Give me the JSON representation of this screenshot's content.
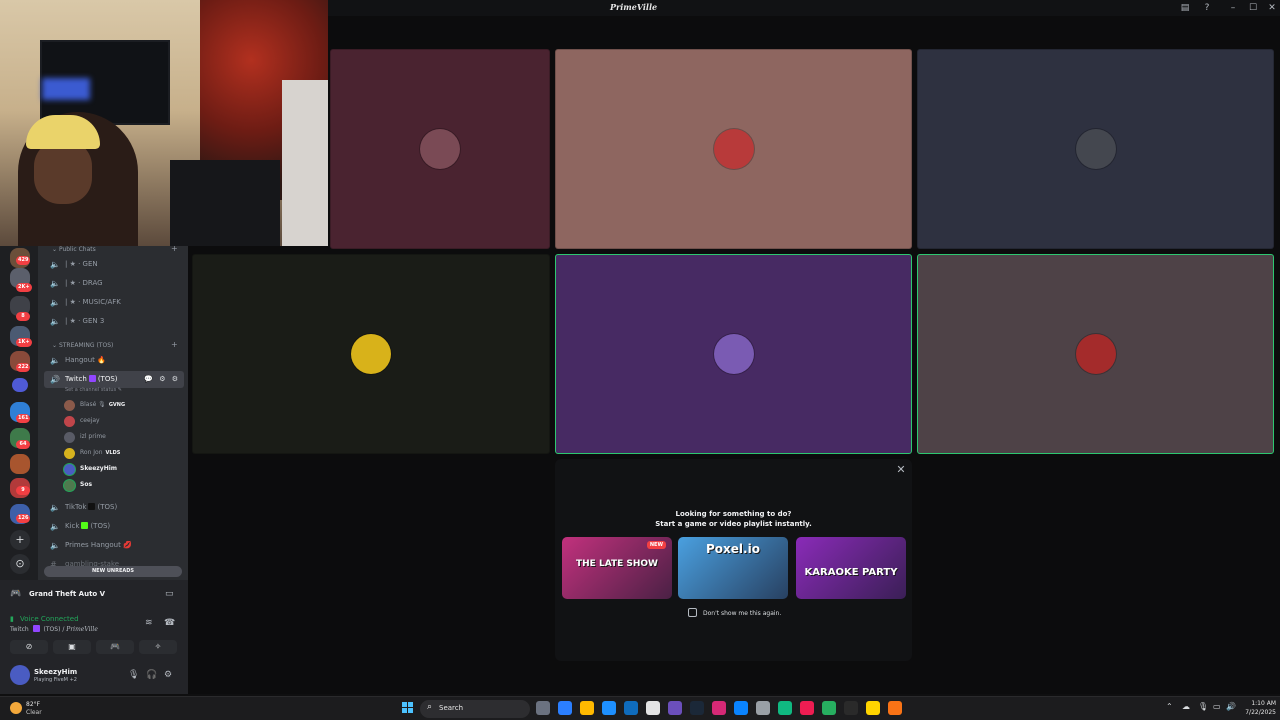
{
  "window": {
    "title": "PrimeVille",
    "controls": {
      "inbox_icon": "inbox-icon",
      "help_icon": "help-icon",
      "minimize": "–",
      "maximize": "☐",
      "close": "✕"
    }
  },
  "server_rail": {
    "badges": [
      "429",
      "2K+",
      "8",
      "1K+",
      "222",
      "161",
      "64",
      "9",
      "126"
    ],
    "add_server_glyph": "+",
    "discover_glyph": "⊙"
  },
  "sidebar": {
    "categories": [
      {
        "label": "Public Chats"
      },
      {
        "label": "STREAMING (TOS)"
      }
    ],
    "public_channels": [
      {
        "label": "| ★ · GEN"
      },
      {
        "label": "| ★ · DRAG"
      },
      {
        "label": "| ★ · MUSIC/AFK"
      },
      {
        "label": "| ★ · GEN 3"
      }
    ],
    "streaming_channels": [
      {
        "label": "Hangout 🔥"
      }
    ],
    "active_channel": {
      "label": "Twitch",
      "suffix": "(TOS)",
      "status": "Set a channel status ✎",
      "tools": "💬 ⚙ ⚙"
    },
    "members": [
      {
        "name": "Blasé 🎙",
        "tag": "GVNG"
      },
      {
        "name": "ceejay",
        "tag": ""
      },
      {
        "name": "izl prime",
        "tag": ""
      },
      {
        "name": "Ron Jon",
        "tag": "VLDS"
      },
      {
        "name": "SkeezyHim",
        "tag": ""
      },
      {
        "name": "Sos",
        "tag": ""
      }
    ],
    "more_channels": [
      {
        "label": "TikTok",
        "suffix": "(TOS)",
        "swatch": "#111111"
      },
      {
        "label": "Kick",
        "suffix": "(TOS)",
        "swatch": "#53fc18"
      },
      {
        "label": "Primes Hangout 💋",
        "suffix": "",
        "swatch": ""
      },
      {
        "label": "gambling-stake",
        "suffix": "",
        "swatch": ""
      }
    ],
    "new_unreads": "NEW UNREADS"
  },
  "user_panel": {
    "game": "Grand Theft Auto V",
    "voice_status": "Voice Connected",
    "voice_channel_prefix": "Twitch",
    "voice_channel_suffix": "(TOS) /",
    "voice_server": "PrimeVille",
    "username": "SkeezyHim",
    "activity": "Playing FiveM +2",
    "buttons": [
      "camera-off-icon",
      "screen-share-icon",
      "activity-icon",
      "soundboard-icon"
    ]
  },
  "stage": {
    "tiles": [
      {
        "bg": "#4a2330",
        "speaking": false,
        "avatar": "#7a4a55"
      },
      {
        "bg": "#8e6660",
        "speaking": false,
        "avatar": "#b83a3a"
      },
      {
        "bg": "#2e3140",
        "speaking": false,
        "avatar": "#44474f"
      },
      {
        "bg": "#1a1c17",
        "speaking": false,
        "avatar": "#d8b21a"
      },
      {
        "bg": "#472a63",
        "speaking": true,
        "avatar": "#7a5bb3"
      },
      {
        "bg": "#4e4247",
        "speaking": true,
        "avatar": "#a42b2b"
      }
    ]
  },
  "activity_popup": {
    "heading": "Looking for something to do?",
    "subheading": "Start a game or video playlist instantly.",
    "cards": [
      {
        "title": "THE LATE SHOW",
        "badge": "NEW",
        "bg": "#c2317d"
      },
      {
        "title": "Poxel.io",
        "badge": "",
        "bg": "#4aa0e0"
      },
      {
        "title": "KARAOKE PARTY",
        "badge": "",
        "bg": "#8a2bb8"
      }
    ],
    "dont_show": "Don't show me this again.",
    "close_glyph": "✕"
  },
  "taskbar": {
    "weather_temp": "82°F",
    "weather_cond": "Clear",
    "search_label": "Search",
    "apps": [
      "#6b7280",
      "#2b7fff",
      "#ffb900",
      "#1e90ff",
      "#0f6cbd",
      "#e4e4e4",
      "#6b4fbb",
      "#1b2838",
      "#d62976",
      "#0a84ff",
      "#9aa0a6",
      "#10b981",
      "#ee1d52",
      "#27ae60",
      "#2a2a2a",
      "#ffd400",
      "#f97316"
    ],
    "time": "1:10 AM",
    "date": "7/22/2025"
  }
}
